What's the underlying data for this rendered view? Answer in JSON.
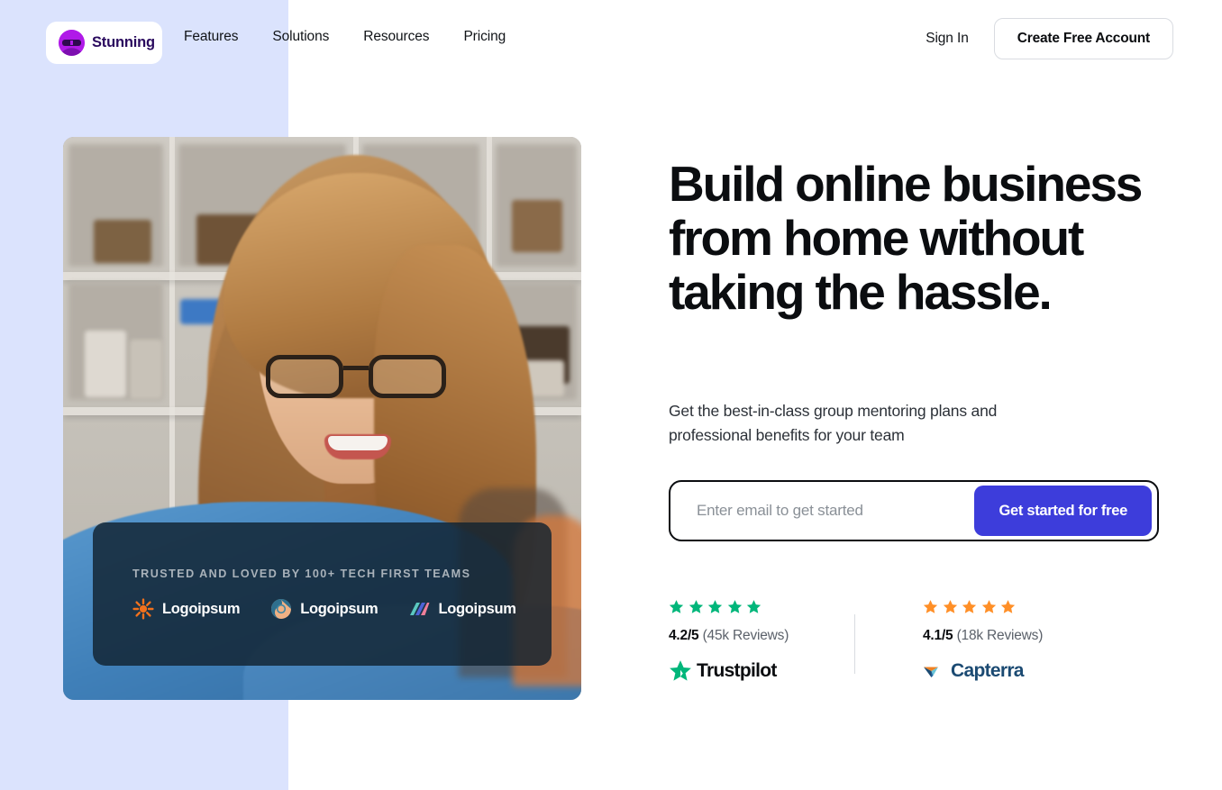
{
  "brand": {
    "name": "Stunning",
    "logo_icon": "stunning-avatar-icon",
    "accent_purple": "#b01ae8",
    "accent_indigo": "#3d3ddb",
    "panel_bg": "#dbe3fd"
  },
  "nav": {
    "items": [
      {
        "label": "Features"
      },
      {
        "label": "Solutions"
      },
      {
        "label": "Resources"
      },
      {
        "label": "Pricing"
      }
    ],
    "sign_in": "Sign In",
    "create_account": "Create Free Account"
  },
  "hero": {
    "headline": "Build online business from home without taking the hassle.",
    "subheading": "Get the best-in-class group mentoring plans and professional benefits for your team",
    "form": {
      "email_placeholder": "Enter email to get started",
      "email_value": "",
      "submit_label": "Get started for free"
    },
    "image_alt": "Smiling woman with glasses in blue sweater working on a laptop at home"
  },
  "trusted": {
    "label": "TRUSTED AND LOVED BY 100+ TECH FIRST TEAMS",
    "logos": [
      {
        "name": "Logoipsum",
        "icon": "sunburst-icon",
        "color": "#f2711c"
      },
      {
        "name": "Logoipsum",
        "icon": "circle-swirl-icon",
        "color": "#4a8da8"
      },
      {
        "name": "Logoipsum",
        "icon": "diagonal-slashes-icon",
        "color": "#5bc8c0"
      }
    ]
  },
  "ratings": [
    {
      "stars": 5,
      "star_color": "#00b67a",
      "score": "4.2/5",
      "reviews": "(45k Reviews)",
      "brand_name": "Trustpilot",
      "brand_icon": "trustpilot-star-icon",
      "brand_text_color": "#0b0d10"
    },
    {
      "stars": 5,
      "star_color": "#ff8f27",
      "score": "4.1/5",
      "reviews": "(18k Reviews)",
      "brand_name": "Capterra",
      "brand_icon": "capterra-arrow-icon",
      "brand_text_color": "#1b4a72"
    }
  ]
}
